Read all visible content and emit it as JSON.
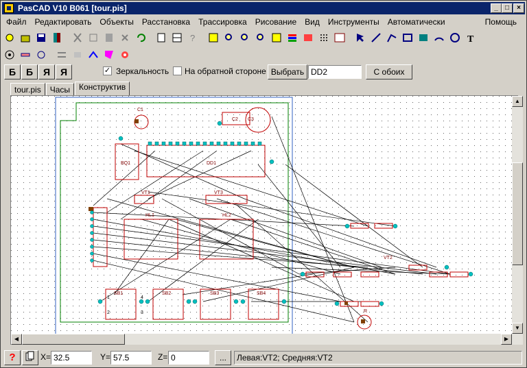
{
  "window": {
    "title": "PasCAD V10 B061 [tour.pis]"
  },
  "menu": {
    "items": [
      "Файл",
      "Редактировать",
      "Объекты",
      "Расстановка",
      "Трассировка",
      "Рисование",
      "Вид",
      "Инструменты",
      "Автоматически"
    ],
    "help": "Помощь"
  },
  "layers": {
    "buttons": [
      "Б",
      "Б",
      "Я",
      "Я"
    ]
  },
  "options": {
    "mirror_label": "Зеркальность",
    "mirror_checked": true,
    "backside_label": "На обратной стороне",
    "backside_checked": false,
    "select_button": "Выбрать",
    "component_value": "DD2",
    "both_button": "С обоих"
  },
  "tabs": [
    "tour.pis",
    "Часы",
    "Конструктив"
  ],
  "active_tab": "Конструктив",
  "board": {
    "components": [
      "C1",
      "C2",
      "C3",
      "DD1",
      "BQ1",
      "VT1",
      "VT2",
      "VT3",
      "HL1",
      "HL2",
      "SB1",
      "SB2",
      "SB3",
      "SB4",
      "R"
    ],
    "pin_labels": [
      "4",
      "1",
      "2",
      "3"
    ]
  },
  "status": {
    "x_label": "X=",
    "x_value": "32.5",
    "y_label": "Y=",
    "y_value": "57.5",
    "z_label": "Z=",
    "z_value": "0",
    "dots": "...",
    "message": "Левая:VT2; Средняя:VT2"
  }
}
